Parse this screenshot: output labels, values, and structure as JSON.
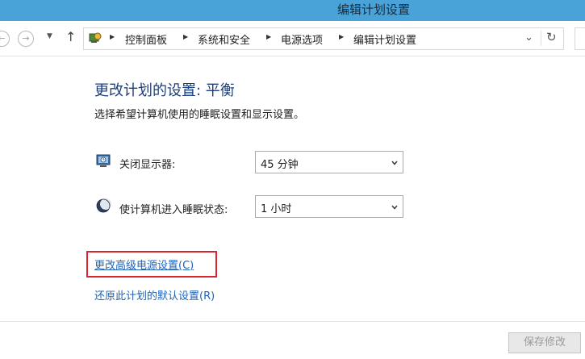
{
  "window": {
    "title": "编辑计划设置"
  },
  "address_bar": {
    "breadcrumbs": [
      "控制面板",
      "系统和安全",
      "电源选项",
      "编辑计划设置"
    ],
    "icons": {
      "back": "back-arrow-icon",
      "forward": "forward-arrow-icon",
      "recent": "chevron-down-icon",
      "up": "up-arrow-icon",
      "control_panel": "control-panel-icon",
      "dropdown": "chevron-down-icon",
      "refresh": "refresh-icon"
    }
  },
  "main": {
    "heading": "更改计划的设置: 平衡",
    "subtitle": "选择希望计算机使用的睡眠设置和显示设置。",
    "settings": [
      {
        "label": "关闭显示器:",
        "value": "45 分钟",
        "icon": "monitor-icon"
      },
      {
        "label": "使计算机进入睡眠状态:",
        "value": "1 小时",
        "icon": "sleep-moon-icon"
      }
    ],
    "links": {
      "advanced": "更改高级电源设置(C)",
      "restore": "还原此计划的默认设置(R)"
    }
  },
  "footer": {
    "save_label": "保存修改"
  },
  "colors": {
    "titlebar": "#4aa3d8",
    "heading": "#1e3e7a",
    "link": "#1e63b8",
    "highlight": "#d8242e"
  }
}
